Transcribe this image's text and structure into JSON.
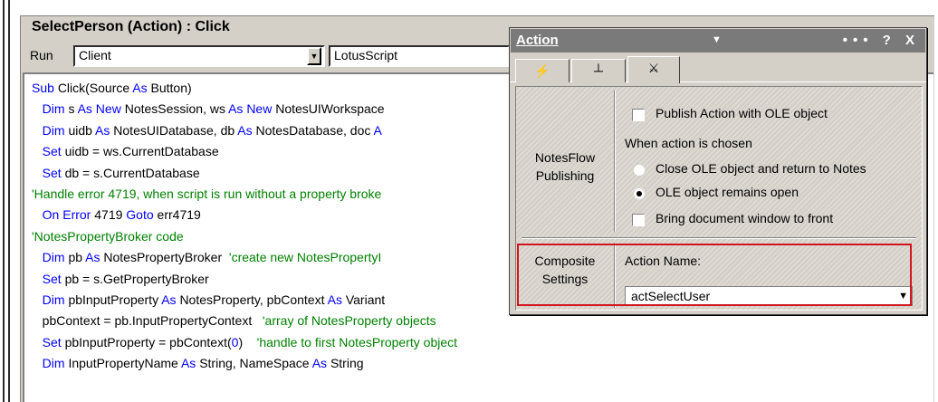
{
  "editor": {
    "title": "SelectPerson (Action) : Click",
    "run_label": "Run",
    "run_target": "Client",
    "language": "LotusScript",
    "code_lines": [
      [
        {
          "t": "kw",
          "v": "Sub "
        },
        {
          "t": "tx",
          "v": "Click(Source "
        },
        {
          "t": "kw",
          "v": "As "
        },
        {
          "t": "tx",
          "v": "Button)"
        }
      ],
      [
        {
          "t": "tx",
          "v": "   "
        },
        {
          "t": "kw",
          "v": "Dim "
        },
        {
          "t": "tx",
          "v": "s "
        },
        {
          "t": "kw",
          "v": "As New "
        },
        {
          "t": "tx",
          "v": "NotesSession, ws "
        },
        {
          "t": "kw",
          "v": "As New "
        },
        {
          "t": "tx",
          "v": "NotesUIWorkspace"
        }
      ],
      [
        {
          "t": "tx",
          "v": "   "
        },
        {
          "t": "kw",
          "v": "Dim "
        },
        {
          "t": "tx",
          "v": "uidb "
        },
        {
          "t": "kw",
          "v": "As "
        },
        {
          "t": "tx",
          "v": "NotesUIDatabase, db "
        },
        {
          "t": "kw",
          "v": "As "
        },
        {
          "t": "tx",
          "v": "NotesDatabase, doc "
        },
        {
          "t": "kw",
          "v": "A"
        }
      ],
      [
        {
          "t": "tx",
          "v": "   "
        },
        {
          "t": "kw",
          "v": "Set "
        },
        {
          "t": "tx",
          "v": "uidb = ws.CurrentDatabase"
        }
      ],
      [
        {
          "t": "tx",
          "v": "   "
        },
        {
          "t": "kw",
          "v": "Set "
        },
        {
          "t": "tx",
          "v": "db = s.CurrentDatabase"
        }
      ],
      [
        {
          "t": "cm",
          "v": "'Handle error 4719, when script is run without a property broke"
        }
      ],
      [
        {
          "t": "tx",
          "v": "   "
        },
        {
          "t": "kw",
          "v": "On Error "
        },
        {
          "t": "tx",
          "v": "4719 "
        },
        {
          "t": "kw",
          "v": "Goto "
        },
        {
          "t": "tx",
          "v": "err4719"
        }
      ],
      [
        {
          "t": "cm",
          "v": "'NotesPropertyBroker code"
        }
      ],
      [
        {
          "t": "tx",
          "v": "   "
        },
        {
          "t": "kw",
          "v": "Dim "
        },
        {
          "t": "tx",
          "v": "pb "
        },
        {
          "t": "kw",
          "v": "As "
        },
        {
          "t": "tx",
          "v": "NotesPropertyBroker  "
        },
        {
          "t": "cm",
          "v": "'create new NotesPropertyI"
        }
      ],
      [
        {
          "t": "tx",
          "v": "   "
        },
        {
          "t": "kw",
          "v": "Set "
        },
        {
          "t": "tx",
          "v": "pb = s.GetPropertyBroker"
        }
      ],
      [
        {
          "t": "tx",
          "v": "   "
        },
        {
          "t": "kw",
          "v": "Dim "
        },
        {
          "t": "tx",
          "v": "pbInputProperty "
        },
        {
          "t": "kw",
          "v": "As "
        },
        {
          "t": "tx",
          "v": "NotesProperty, pbContext "
        },
        {
          "t": "kw",
          "v": "As "
        },
        {
          "t": "tx",
          "v": "Variant"
        }
      ],
      [
        {
          "t": "tx",
          "v": "   pbContext = pb.InputPropertyContext   "
        },
        {
          "t": "cm",
          "v": "'array of NotesProperty objects"
        }
      ],
      [
        {
          "t": "tx",
          "v": "   "
        },
        {
          "t": "kw",
          "v": "Set "
        },
        {
          "t": "tx",
          "v": "pbInputProperty = pbContext("
        },
        {
          "t": "kw",
          "v": "0"
        },
        {
          "t": "tx",
          "v": ")    "
        },
        {
          "t": "cm",
          "v": "'handle to first NotesProperty object"
        }
      ],
      [
        {
          "t": "tx",
          "v": "   "
        },
        {
          "t": "kw",
          "v": "Dim "
        },
        {
          "t": "tx",
          "v": "InputPropertyName "
        },
        {
          "t": "kw",
          "v": "As "
        },
        {
          "t": "tx",
          "v": "String, NameSpace "
        },
        {
          "t": "kw",
          "v": "As "
        },
        {
          "t": "tx",
          "v": "String"
        }
      ]
    ]
  },
  "dialog": {
    "title": "Action",
    "controls": "••• ? X",
    "tabs": [
      "⚡",
      "┴",
      "⚔"
    ],
    "notesflow_label": "NotesFlow Publishing",
    "publish_label": "Publish Action with OLE object",
    "when_chosen_label": "When action is chosen",
    "radio_close": "Close OLE object and return to Notes",
    "radio_open": "OLE object remains open",
    "bring_front_label": "Bring document window to front",
    "composite_label": "Composite Settings",
    "action_name_label": "Action Name:",
    "action_name_value": "actSelectUser"
  },
  "colors": {
    "keyword": "#0000ff",
    "comment": "#008000",
    "highlight": "#d2141e"
  }
}
